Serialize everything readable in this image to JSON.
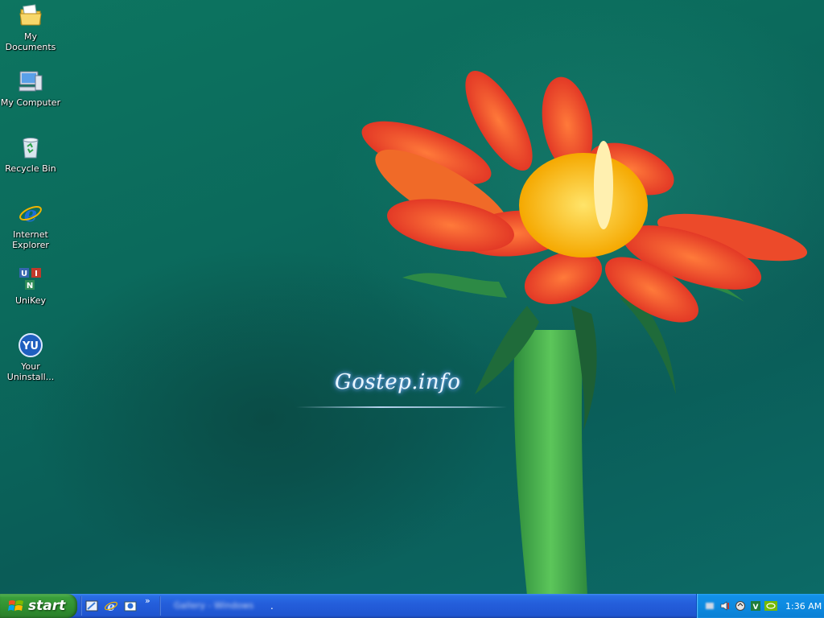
{
  "desktop": {
    "icons": [
      {
        "label": "My Documents",
        "icon": "my-documents-icon"
      },
      {
        "label": "My Computer",
        "icon": "my-computer-icon"
      },
      {
        "label": "Recycle Bin",
        "icon": "recycle-bin-icon"
      },
      {
        "label": "Internet Explorer",
        "icon": "internet-explorer-icon"
      },
      {
        "label": "UniKey",
        "icon": "unikey-icon"
      },
      {
        "label": "Your Uninstall...",
        "icon": "your-uninstaller-icon"
      }
    ],
    "wallpaper_text": "Gostep.info",
    "colors": {
      "wallpaper": "#0b6a5c",
      "petal": "#e8402b",
      "stem": "#3fae4f"
    }
  },
  "taskbar": {
    "start_label": "start",
    "quick_launch": [
      "show-desktop-icon",
      "internet-explorer-icon",
      "outlook-express-icon"
    ],
    "more_label": "»",
    "task_button_label": "Gallery - Windows",
    "task_dot": ".",
    "tray_icons": [
      "network-icon",
      "volume-icon",
      "antivirus-icon",
      "unikey-tray-icon",
      "nvidia-icon"
    ],
    "clock": "1:36 AM",
    "colors": {
      "start_green": "#2f8f2f",
      "bar_blue": "#245edb",
      "tray_blue": "#0d8ae0"
    }
  }
}
